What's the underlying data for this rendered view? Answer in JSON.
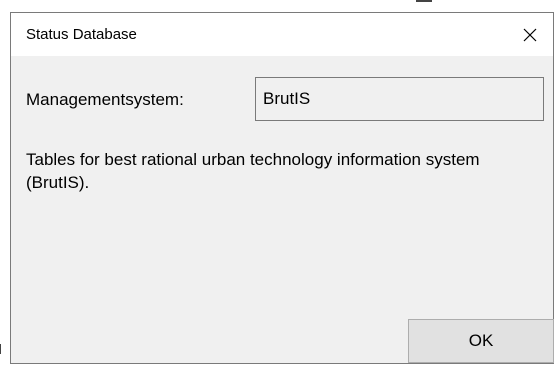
{
  "dialog": {
    "title": "Status Database",
    "close_icon": "close-x-icon"
  },
  "field": {
    "label": "Managementsystem:",
    "value": "BrutIS"
  },
  "description": "Tables for best rational urban technology information system (BrutIS).",
  "buttons": {
    "ok_label": "OK"
  }
}
